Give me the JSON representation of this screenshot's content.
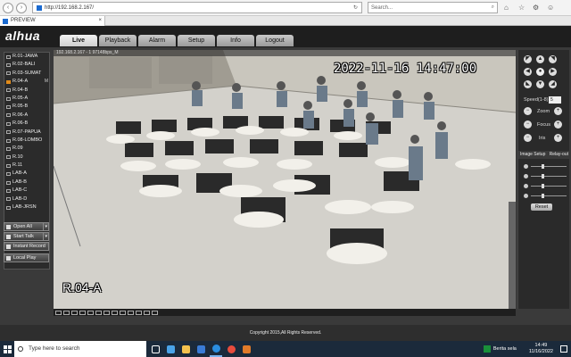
{
  "browser": {
    "url": "http://192.168.2.167/",
    "search_placeholder": "Search...",
    "tab_title": "PREVIEW"
  },
  "app": {
    "logo": "alhua",
    "menu": [
      "Live",
      "Playback",
      "Alarm",
      "Setup",
      "Info",
      "Logout"
    ],
    "active_menu": "Live"
  },
  "sidebar": {
    "channels": [
      {
        "label": "R.01-JAWA",
        "selected": false
      },
      {
        "label": "R.02-BALI",
        "selected": false
      },
      {
        "label": "R.03-SUMAT",
        "selected": false
      },
      {
        "label": "R.04-A",
        "selected": true,
        "badge": "M"
      },
      {
        "label": "R.04-B",
        "selected": false
      },
      {
        "label": "R.05-A",
        "selected": false
      },
      {
        "label": "R.05-B",
        "selected": false
      },
      {
        "label": "R.06-A",
        "selected": false
      },
      {
        "label": "R.06-B",
        "selected": false
      },
      {
        "label": "R.07-PAPUA",
        "selected": false
      },
      {
        "label": "R.08-LOMBO",
        "selected": false
      },
      {
        "label": "R.09",
        "selected": false
      },
      {
        "label": "R.10",
        "selected": false
      },
      {
        "label": "R.11",
        "selected": false
      },
      {
        "label": "LAB-A",
        "selected": false
      },
      {
        "label": "LAB-B",
        "selected": false
      },
      {
        "label": "LAB-C",
        "selected": false
      },
      {
        "label": "LAB-D",
        "selected": false
      },
      {
        "label": "LAB-JRSN",
        "selected": false
      }
    ],
    "buttons": {
      "open_all": "Open All",
      "start_talk": "Start Talk",
      "instant_record": "Instant Record",
      "local_play": "Local Play"
    }
  },
  "video": {
    "title": "192.168.2.167 - 1 97148bps_M",
    "timestamp": "2022-11-16  14:47:00",
    "camera_name": "R.04-A"
  },
  "ptz": {
    "speed_label": "Speed(1-8)",
    "speed_value": "5",
    "zoom_label": "Zoom",
    "focus_label": "Focus",
    "iris_label": "Iris",
    "image_setup_label": "Image Setup",
    "relay_label": "Relay-out",
    "reset_label": "Reset"
  },
  "footer": {
    "copyright": "Copyright 2015,All Rights Reserved."
  },
  "taskbar": {
    "search_placeholder": "Type here to search",
    "news": "Berita sela",
    "time": "14:49",
    "date": "11/16/2022"
  }
}
